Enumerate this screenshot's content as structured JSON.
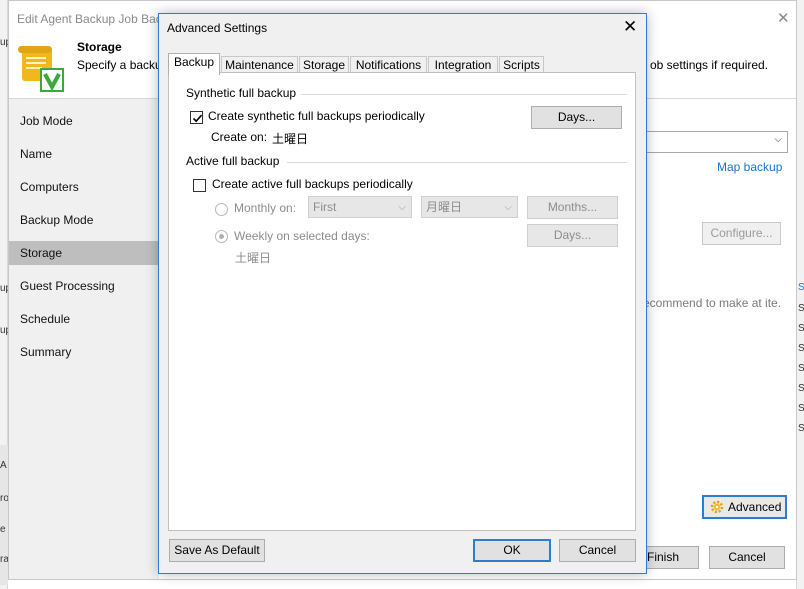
{
  "background_window": {
    "title": "Edit Agent Backup Job Back",
    "close_glyph": "✕",
    "header": {
      "heading": "Storage",
      "description_start": "Specify a backu",
      "description_end": "ob settings if required."
    },
    "nav": [
      "Job Mode",
      "Name",
      "Computers",
      "Backup Mode",
      "Storage",
      "Guest Processing",
      "Schedule",
      "Summary"
    ],
    "active_nav": "Storage",
    "map_backup_link": "Map backup",
    "configure_button": "Configure...",
    "recommend_text": "ecommend to make at ite.",
    "advanced_button": "Advanced",
    "finish_button": "Finish",
    "cancel_button": "Cancel",
    "edge_fragments_left": [
      "up",
      "up",
      "up",
      "A",
      "ro",
      "e",
      "ra"
    ],
    "edge_fragments_right": [
      "S",
      "S",
      "S",
      "S",
      "S",
      "S",
      "S",
      "S"
    ]
  },
  "dialog": {
    "title": "Advanced Settings",
    "close_glyph": "✕",
    "tabs": [
      "Backup",
      "Maintenance",
      "Storage",
      "Notifications",
      "Integration",
      "Scripts"
    ],
    "active_tab": "Backup",
    "synthetic": {
      "group_label": "Synthetic full backup",
      "checkbox_label": "Create synthetic full backups periodically",
      "checked": true,
      "create_on_label": "Create on:",
      "create_on_value": "土曜日",
      "days_button": "Days..."
    },
    "active_full": {
      "group_label": "Active full backup",
      "checkbox_label": "Create active full backups periodically",
      "checked": false,
      "monthly_label": "Monthly on:",
      "monthly_week": "First",
      "monthly_day": "月曜日",
      "months_button": "Months...",
      "weekly_label": "Weekly on selected days:",
      "weekly_value": "土曜日",
      "days_button": "Days...",
      "selected_option": "weekly"
    },
    "save_default_button": "Save As Default",
    "ok_button": "OK",
    "cancel_button": "Cancel"
  },
  "colors": {
    "accent": "#2c7dd2",
    "link": "#1a74c7",
    "nav_background": "#f0f0f0",
    "nav_active": "#bebebe",
    "disabled_text": "#8d8d8d",
    "icon_green": "#3aa83c",
    "icon_yellow": "#f3b71e"
  }
}
